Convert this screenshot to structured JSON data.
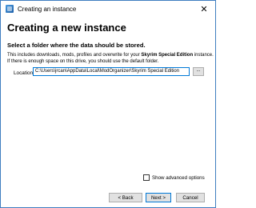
{
  "window": {
    "title": "Creating an instance",
    "close_glyph": "✕",
    "app_icon": "mod-organizer-icon"
  },
  "header": {
    "heading": "Creating a new instance"
  },
  "main": {
    "subheading": "Select a folder where the data should be stored.",
    "description_part1": "This includes downloads, mods, profiles and overwrite for your ",
    "description_game": "Skyrim Special Edition",
    "description_part2": " instance. If there is enough space on this drive, you should use the default folder.",
    "location_label": "Location",
    "location_value": "C:\\Users\\jrcan\\AppData\\Local\\ModOrganizer\\Skyrim Special Edition",
    "browse_label": "...",
    "advanced_label": "Show advanced options",
    "advanced_checked": false
  },
  "buttons": {
    "back": "< Back",
    "next": "Next >",
    "cancel": "Cancel"
  },
  "colors": {
    "accent": "#0078d7",
    "window_border": "#3f7ec0"
  }
}
